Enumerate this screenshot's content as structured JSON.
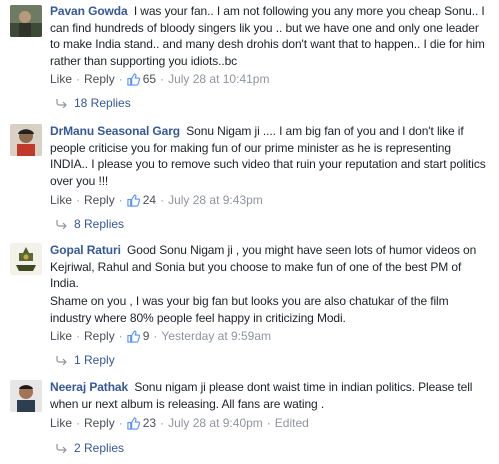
{
  "comments": [
    {
      "author": "Pavan Gowda",
      "text": "I was your fan.. I am not following you any more you cheap Sonu.. I can find hundreds of bloody singers lik you .. but we have one and only one leader to make India stand.. and many desh drohis don't want that to happen.. I die for him rather than supporting you idiots..bc",
      "like": "Like",
      "reply": "Reply",
      "likes": "65",
      "time": "July 28 at 10:41pm",
      "edited": "",
      "replies": "18 Replies"
    },
    {
      "author": "DrManu Seasonal Garg",
      "text": "Sonu Nigam ji .... I am big fan of you and I don't like if people criticise you for making fun of our prime minister as he is representing INDIA.. I please you to remove such video that ruin your reputation and start politics over you !!!",
      "like": "Like",
      "reply": "Reply",
      "likes": "24",
      "time": "July 28 at 9:43pm",
      "edited": "",
      "replies": "8 Replies"
    },
    {
      "author": "Gopal Raturi",
      "text": "Good Sonu Nigam ji , you might have seen lots of humor videos on Kejriwal, Rahul and Sonia but you choose to make fun of one of the best PM of India.",
      "text2": "Shame on you , I was your big fan but looks you are also chatukar of the film industry where 80% people feel happy in criticizing Modi.",
      "like": "Like",
      "reply": "Reply",
      "likes": "9",
      "time": "Yesterday at 9:59am",
      "edited": "",
      "replies": "1 Reply"
    },
    {
      "author": "Neeraj Pathak",
      "text": "Sonu nigam ji please dont waist time in indian politics. Please tell when ur next album is releasing. All fans are wating .",
      "like": "Like",
      "reply": "Reply",
      "likes": "23",
      "time": "July 28 at 9:40pm",
      "edited": "Edited",
      "replies": "2 Replies"
    }
  ],
  "colors": {
    "link": "#365899",
    "meta": "#90949c",
    "text": "#1d2129"
  }
}
